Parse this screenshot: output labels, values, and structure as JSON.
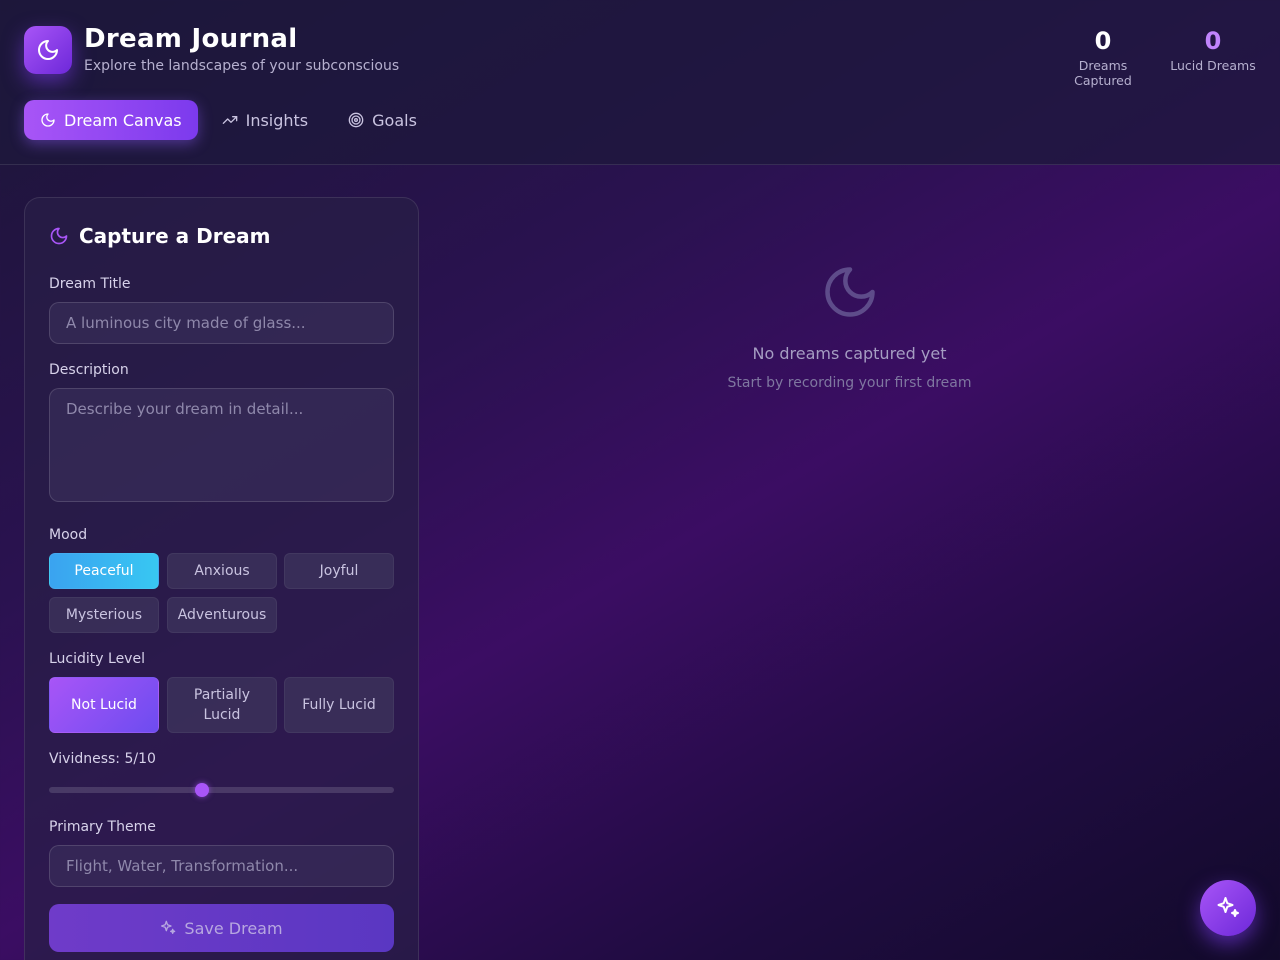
{
  "header": {
    "title": "Dream Journal",
    "subtitle": "Explore the landscapes of your subconscious",
    "logo_icon": "moon-icon"
  },
  "stats": {
    "dreams_captured": {
      "value": "0",
      "label": "Dreams Captured"
    },
    "lucid_dreams": {
      "value": "0",
      "label": "Lucid Dreams",
      "color": "#c084fc"
    }
  },
  "tabs": [
    {
      "label": "Dream Canvas",
      "icon": "moon-icon",
      "active": true
    },
    {
      "label": "Insights",
      "icon": "trending-up-icon",
      "active": false
    },
    {
      "label": "Goals",
      "icon": "target-icon",
      "active": false
    }
  ],
  "form": {
    "title": "Capture a Dream",
    "dream_title": {
      "label": "Dream Title",
      "placeholder": "A luminous city made of glass...",
      "value": ""
    },
    "description": {
      "label": "Description",
      "placeholder": "Describe your dream in detail...",
      "value": ""
    },
    "mood": {
      "label": "Mood",
      "options": [
        "Peaceful",
        "Anxious",
        "Joyful",
        "Mysterious",
        "Adventurous"
      ],
      "selected": "Peaceful"
    },
    "lucidity": {
      "label": "Lucidity Level",
      "options": [
        "Not Lucid",
        "Partially Lucid",
        "Fully Lucid"
      ],
      "selected": "Not Lucid"
    },
    "vividness": {
      "label": "Vividness: 5/10",
      "value": 5,
      "min": 1,
      "max": 10
    },
    "theme": {
      "label": "Primary Theme",
      "placeholder": "Flight, Water, Transformation...",
      "value": ""
    },
    "save_label": "Save Dream"
  },
  "empty_state": {
    "title": "No dreams captured yet",
    "subtitle": "Start by recording your first dream"
  },
  "colors": {
    "accent": "#a855f7",
    "accent_dark": "#6d28d9",
    "mood_active": "#38c7f2"
  }
}
